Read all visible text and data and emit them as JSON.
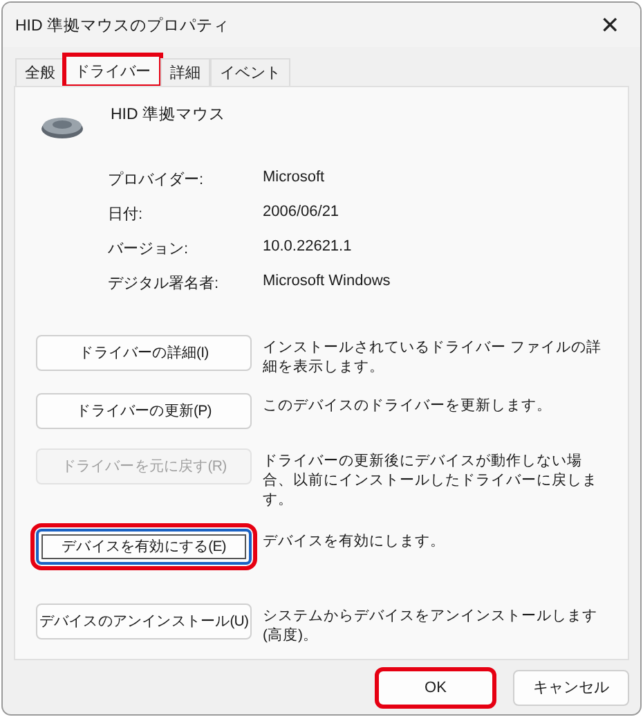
{
  "window": {
    "title": "HID 準拠マウスのプロパティ",
    "close": "✕"
  },
  "tabs": [
    {
      "label": "全般",
      "selected": false,
      "highlighted": false
    },
    {
      "label": "ドライバー",
      "selected": true,
      "highlighted": true
    },
    {
      "label": "詳細",
      "selected": false,
      "highlighted": false
    },
    {
      "label": "イベント",
      "selected": false,
      "highlighted": false
    }
  ],
  "device": {
    "name": "HID 準拠マウス"
  },
  "properties": [
    {
      "label": "プロバイダー:",
      "value": "Microsoft"
    },
    {
      "label": "日付:",
      "value": "2006/06/21"
    },
    {
      "label": "バージョン:",
      "value": "10.0.22621.1"
    },
    {
      "label": "デジタル署名者:",
      "value": "Microsoft Windows"
    }
  ],
  "actions": [
    {
      "button": "ドライバーの詳細(I)",
      "description": "インストールされているドライバー ファイルの詳細を表示します。",
      "disabled": false,
      "focused": false,
      "highlighted": false
    },
    {
      "button": "ドライバーの更新(P)",
      "description": "このデバイスのドライバーを更新します。",
      "disabled": false,
      "focused": false,
      "highlighted": false
    },
    {
      "button": "ドライバーを元に戻す(R)",
      "description": "ドライバーの更新後にデバイスが動作しない場合、以前にインストールしたドライバーに戻します。",
      "disabled": true,
      "focused": false,
      "highlighted": false
    },
    {
      "button": "デバイスを有効にする(E)",
      "description": "デバイスを有効にします。",
      "disabled": false,
      "focused": true,
      "highlighted": true
    },
    {
      "button": "デバイスのアンインストール(U)",
      "description": "システムからデバイスをアンインストールします (高度)。",
      "disabled": false,
      "focused": false,
      "highlighted": false
    }
  ],
  "footer_buttons": [
    {
      "label": "OK",
      "highlighted": true
    },
    {
      "label": "キャンセル",
      "highlighted": false
    }
  ]
}
